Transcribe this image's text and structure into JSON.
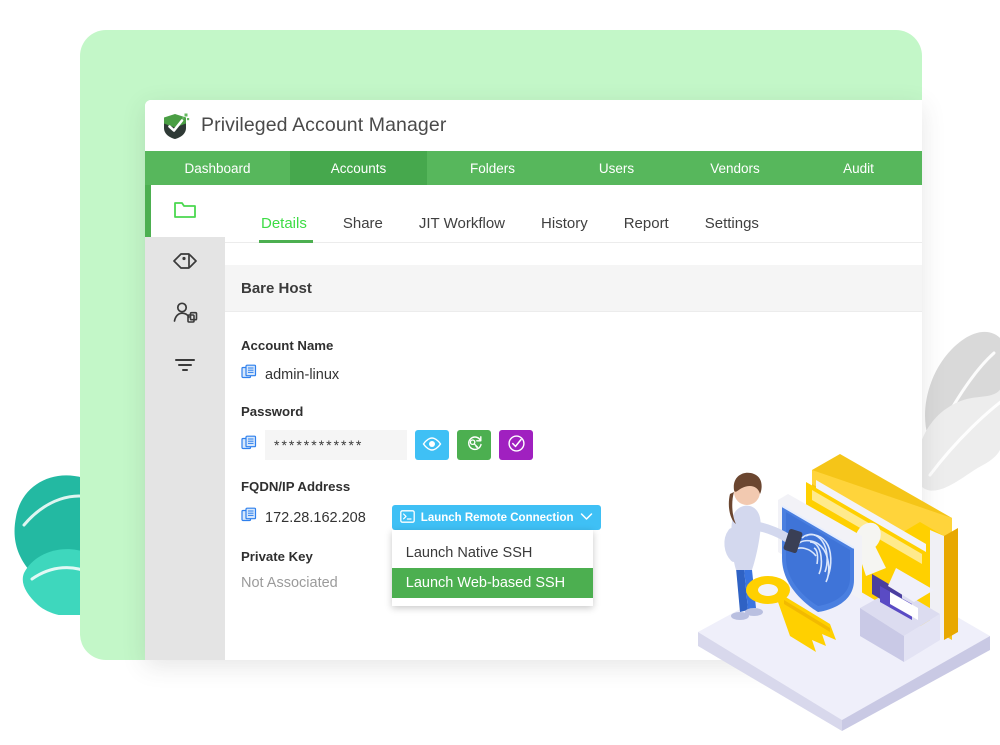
{
  "app": {
    "title": "Privileged Account Manager",
    "logo_icon": "shield-check-icon"
  },
  "topnav": {
    "items": [
      {
        "label": "Dashboard",
        "active": false
      },
      {
        "label": "Accounts",
        "active": true
      },
      {
        "label": "Folders",
        "active": false
      },
      {
        "label": "Users",
        "active": false
      },
      {
        "label": "Vendors",
        "active": false
      },
      {
        "label": "Audit",
        "active": false
      }
    ]
  },
  "icon_rail": {
    "items": [
      {
        "icon": "folder-icon",
        "active": true
      },
      {
        "icon": "tags-icon",
        "active": false
      },
      {
        "icon": "user-copy-icon",
        "active": false
      },
      {
        "icon": "filter-icon",
        "active": false
      }
    ]
  },
  "subtabs": {
    "items": [
      {
        "label": "Details",
        "active": true
      },
      {
        "label": "Share",
        "active": false
      },
      {
        "label": "JIT Workflow",
        "active": false
      },
      {
        "label": "History",
        "active": false
      },
      {
        "label": "Report",
        "active": false
      },
      {
        "label": "Settings",
        "active": false
      }
    ]
  },
  "section": {
    "title": "Bare Host"
  },
  "form": {
    "account_name": {
      "label": "Account Name",
      "value": "admin-linux",
      "copy_icon": "copy-icon"
    },
    "password": {
      "label": "Password",
      "value": "************",
      "copy_icon": "copy-icon",
      "buttons": [
        {
          "icon": "eye-icon",
          "color": "#3fc0f5"
        },
        {
          "icon": "refresh-key-icon",
          "color": "#4caf50"
        },
        {
          "icon": "check-circle-icon",
          "color": "#a020c0"
        }
      ]
    },
    "fqdn": {
      "label": "FQDN/IP Address",
      "value": "172.28.162.208",
      "copy_icon": "copy-icon"
    },
    "private_key": {
      "label": "Private Key",
      "value": "Not Associated"
    }
  },
  "launch_dropdown": {
    "button_label": "Launch Remote Connection",
    "button_icon": "terminal-icon",
    "chevron_icon": "chevron-down-icon",
    "open": true,
    "options": [
      {
        "label": "Launch Native SSH",
        "selected": false
      },
      {
        "label": "Launch Web-based SSH",
        "selected": true
      }
    ]
  },
  "decor": {
    "panel_color": "#c3f7c8",
    "nav_color": "#57b75c",
    "accent_color": "#4caf50",
    "leaves_left_color": "#2ec5ab",
    "leaves_right_color": "#e8e8e8",
    "illustration": "isometric-security-illustration"
  }
}
